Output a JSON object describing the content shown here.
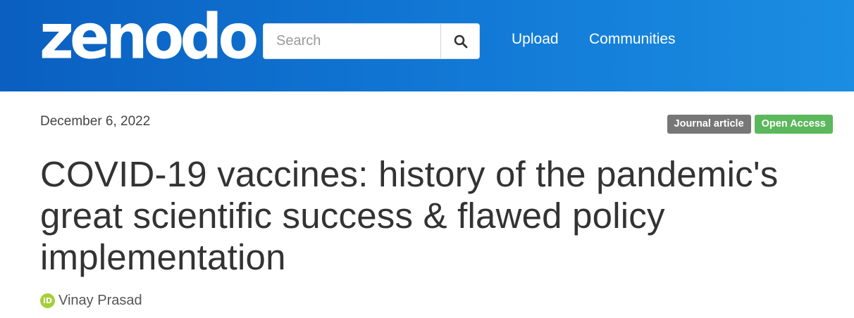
{
  "brand": {
    "logo_text": "zenodo"
  },
  "search": {
    "placeholder": "Search",
    "value": ""
  },
  "nav": {
    "upload_label": "Upload",
    "communities_label": "Communities"
  },
  "record": {
    "date": "December 6, 2022",
    "badges": {
      "type": "Journal article",
      "access": "Open Access"
    },
    "title": "COVID-19 vaccines: history of the pandemic's great scientific success & flawed policy implementation",
    "author": "Vinay Prasad"
  },
  "icons": {
    "search": "search-icon",
    "orcid": "orcid-icon"
  },
  "colors": {
    "navbar_start": "#0a5fc0",
    "navbar_end": "#1b8de2",
    "badge_type": "#777777",
    "badge_access": "#5cb85c",
    "orcid": "#a6ce39"
  }
}
